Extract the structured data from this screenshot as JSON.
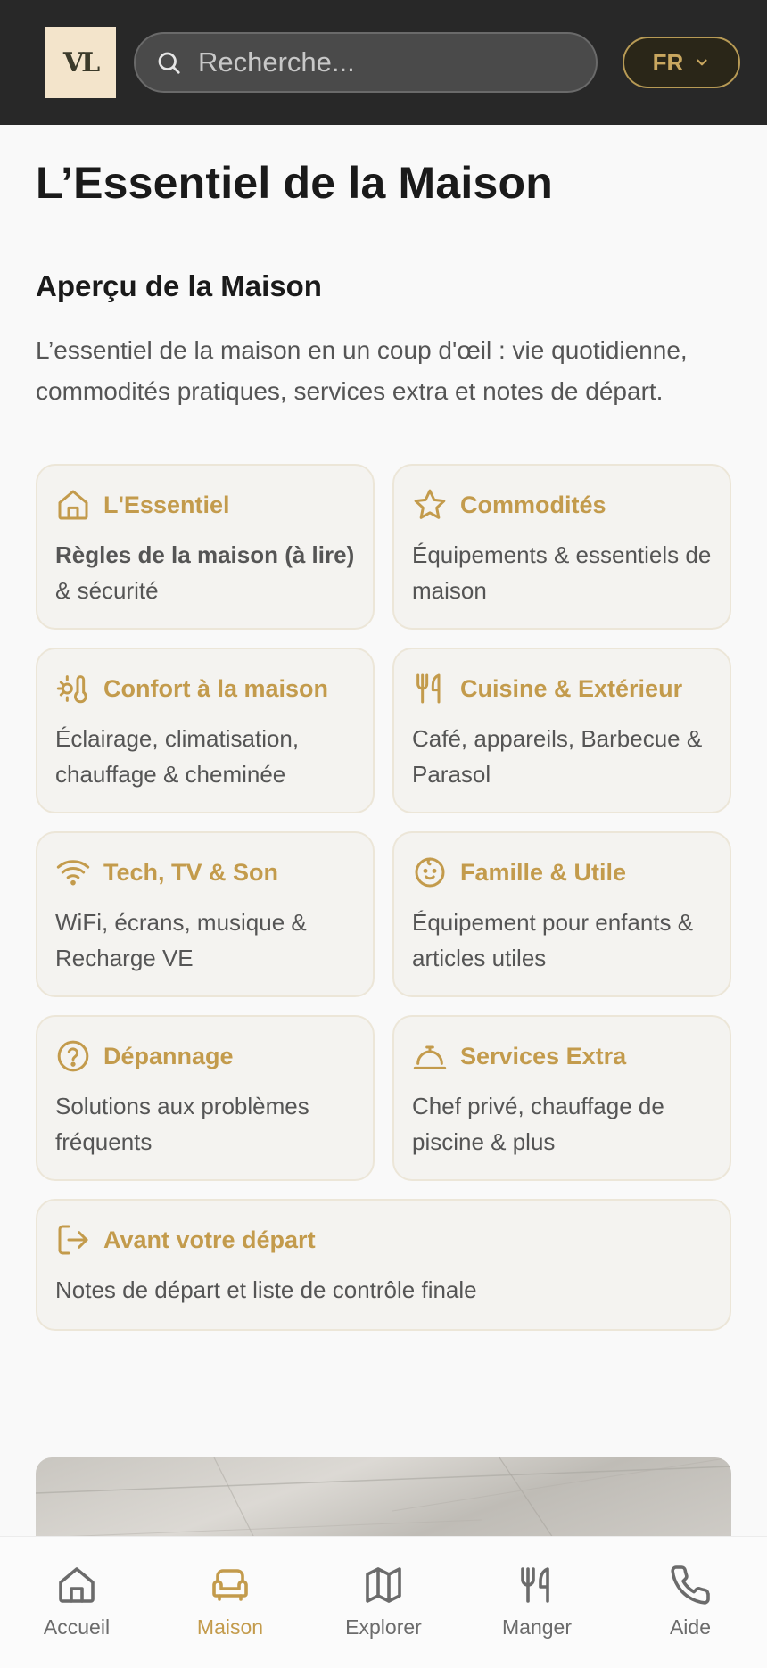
{
  "header": {
    "logo_text": "VL",
    "search_placeholder": "Recherche...",
    "language": "FR"
  },
  "main": {
    "page_title": "L’Essentiel de la Maison",
    "section_title": "Aperçu de la Maison",
    "section_desc": "L’essentiel de la maison en un coup d'œil : vie quotidienne, commodités pratiques, services extra et notes de départ.",
    "cards": [
      {
        "icon": "house-icon",
        "title": "L'Essentiel",
        "desc_bold": "Règles de la maison (à lire)",
        "desc": " & sécurité"
      },
      {
        "icon": "star-icon",
        "title": "Commodités",
        "desc": "Équipements & essentiels de maison"
      },
      {
        "icon": "sun-thermometer-icon",
        "title": "Confort à la maison",
        "desc": "Éclairage, climatisation, chauffage & cheminée"
      },
      {
        "icon": "utensils-icon",
        "title": "Cuisine & Extérieur",
        "desc": "Café, appareils, Barbecue & Parasol"
      },
      {
        "icon": "wifi-icon",
        "title": "Tech, TV & Son",
        "desc": "WiFi, écrans, musique & Recharge VE"
      },
      {
        "icon": "baby-icon",
        "title": "Famille & Utile",
        "desc": "Équipement pour enfants & articles utiles"
      },
      {
        "icon": "help-circle-icon",
        "title": "Dépannage",
        "desc": "Solutions aux problèmes fréquents"
      },
      {
        "icon": "concierge-bell-icon",
        "title": "Services Extra",
        "desc": "Chef privé, chauffage de piscine & plus"
      },
      {
        "icon": "log-out-icon",
        "title": "Avant votre départ",
        "desc": "Notes de départ et liste de contrôle finale"
      }
    ]
  },
  "bottom_nav": [
    {
      "icon": "home-icon",
      "label": "Accueil",
      "active": false
    },
    {
      "icon": "sofa-icon",
      "label": "Maison",
      "active": true
    },
    {
      "icon": "map-icon",
      "label": "Explorer",
      "active": false
    },
    {
      "icon": "utensils-icon",
      "label": "Manger",
      "active": false
    },
    {
      "icon": "phone-icon",
      "label": "Aide",
      "active": false
    }
  ],
  "colors": {
    "accent": "#c39b4c",
    "header_bg": "#282828",
    "card_bg": "#f4f3f0"
  }
}
